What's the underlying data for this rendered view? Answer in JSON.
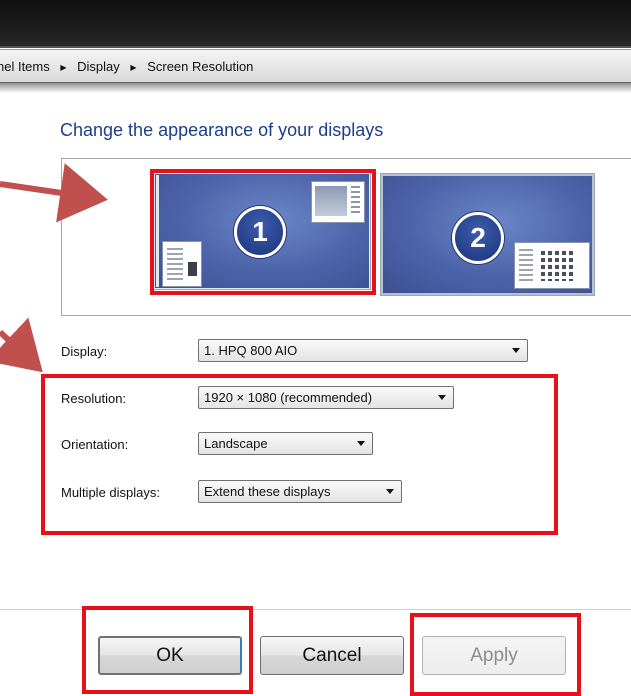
{
  "breadcrumb": {
    "items": [
      "nel Items",
      "Display",
      "Screen Resolution"
    ]
  },
  "heading": "Change the appearance of your displays",
  "monitors": [
    {
      "number": "1",
      "selected": true
    },
    {
      "number": "2",
      "selected": false
    }
  ],
  "settings": {
    "display": {
      "label": "Display:",
      "value": "1. HPQ 800 AIO"
    },
    "resolution": {
      "label": "Resolution:",
      "value": "1920 × 1080 (recommended)"
    },
    "orientation": {
      "label": "Orientation:",
      "value": "Landscape"
    },
    "multiple_displays": {
      "label": "Multiple displays:",
      "value": "Extend these displays"
    }
  },
  "buttons": {
    "ok": "OK",
    "cancel": "Cancel",
    "apply": "Apply"
  },
  "colors": {
    "heading": "#1a3e8c",
    "highlight": "#e8101b",
    "arrow": "#c0504d",
    "monitor": "#4d63a9"
  },
  "icons": [
    "caret-down-icon",
    "arrow-annotation-icon",
    "breadcrumb-separator-icon"
  ]
}
